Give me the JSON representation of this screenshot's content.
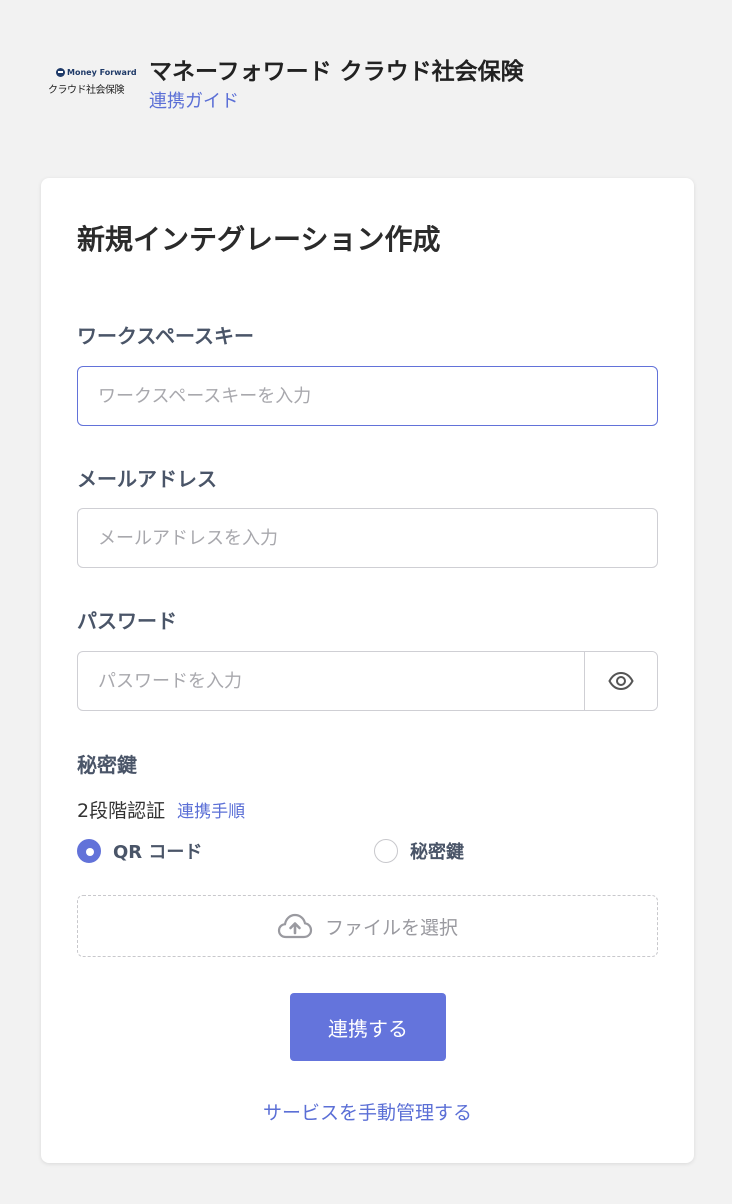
{
  "header": {
    "logo_brand": "Money Forward",
    "logo_product": "クラウド社会保険",
    "title": "マネーフォワード クラウド社会保険",
    "guide_link": "連携ガイド"
  },
  "form": {
    "title": "新規インテグレーション作成",
    "workspace_key": {
      "label": "ワークスペースキー",
      "placeholder": "ワークスペースキーを入力",
      "value": ""
    },
    "email": {
      "label": "メールアドレス",
      "placeholder": "メールアドレスを入力",
      "value": ""
    },
    "password": {
      "label": "パスワード",
      "placeholder": "パスワードを入力",
      "value": "",
      "toggle_icon": "eye-icon"
    },
    "secret_key": {
      "label": "秘密鍵"
    },
    "two_factor": {
      "label": "2段階認証",
      "link": "連携手順",
      "options": [
        {
          "label": "QR コード",
          "checked": true
        },
        {
          "label": "秘密鍵",
          "checked": false
        }
      ]
    },
    "upload": {
      "label": "ファイルを選択",
      "icon": "cloud-upload-icon"
    },
    "submit_label": "連携する",
    "manual_link": "サービスを手動管理する"
  },
  "colors": {
    "accent": "#6474dc",
    "link": "#5b6fd6",
    "background": "#f2f2f2",
    "card": "#ffffff"
  }
}
